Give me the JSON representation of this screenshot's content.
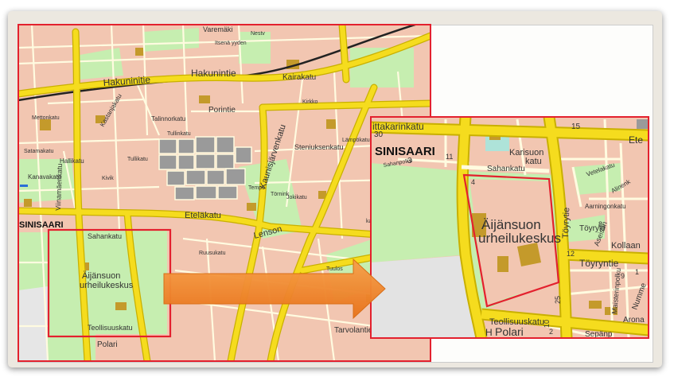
{
  "colors": {
    "road_major": "#f5dc1e",
    "road_major_edge": "#c9b000",
    "land": "#f2c6b1",
    "park": "#c6eeb0",
    "built": "#9a9a9a",
    "highlight": "#e3212e",
    "arrow": "#f08a24",
    "building": "#c49a2b"
  },
  "overview": {
    "streets": [
      "Hakuninitie",
      "Hakunintie",
      "Kairakatu",
      "Porintie",
      "Kaunisjärvenkatu",
      "Eteläkatu",
      "Lenson",
      "Steniuksenkatu",
      "Sahankatu",
      "Teollisuuskatu",
      "Kanavakatu",
      "Viinamäenkatu",
      "Varemäki",
      "Tarvolantie",
      "Hallikatu",
      "Polari"
    ],
    "district": "SINISAARI",
    "streets_west": [
      "Talinnorkatu",
      "Kastanjakatu"
    ],
    "facility": [
      "Äijänsuon",
      "urheilukeskus"
    ],
    "labels": [
      "Nestv",
      "Itsenä yyden",
      "Satamakatu",
      "Tullikatu",
      "Kivik",
      "Jokikatu",
      "Lämpökatu",
      "Tempo",
      "Törnink",
      "Ruusukatu",
      "Tuulos",
      "Kirkko",
      "Tullinkatu",
      "Mettonkatu",
      "katu"
    ]
  },
  "zoom": {
    "district": "SINISAARI",
    "streets_top": "ittakarinkatu",
    "street_top_right": "Ete",
    "street_karisuon": [
      "Karisuon",
      "katu"
    ],
    "street_sahankatu": "Sahankatu",
    "facility": [
      "Äijänsuon",
      "urheilukeskus"
    ],
    "street_toyrytie_v": "Töyrytie",
    "street_toyryk": "Töyrykl",
    "street_kollaan": "Kollaan",
    "street_toyryntie": "Töyryntie",
    "street_teollisuus": "Teollisuuskatu",
    "street_polari": "Polari",
    "street_sepanp": "Sepänp",
    "street_arona": "Arona",
    "street_aseisan": "Aseisan",
    "street_maisterin": "Maisterinpolku",
    "street_numme": "Numme",
    "street_alinenk": "Alinenk",
    "street_aarningon": "Aarningonkatu",
    "street_vetelak": "Vetelakatu",
    "street_sahanpolku": "Sahanpolku",
    "letter_h": "H",
    "numbers": [
      "30",
      "3",
      "15",
      "12",
      "25",
      "1",
      "2",
      "10",
      "8",
      "9",
      "11",
      "4"
    ]
  }
}
